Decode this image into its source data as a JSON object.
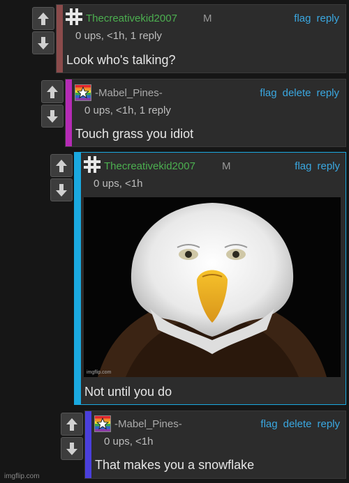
{
  "colors": {
    "background": "#161616",
    "card": "#2c2c2c",
    "link": "#3aa7e0",
    "green_user": "#4caf50",
    "bar_1": "#8b4b4b",
    "bar_2": "#b52bb5",
    "bar_3": "#1aa9e0",
    "bar_4": "#4a3fdc"
  },
  "comments": [
    {
      "username": "Thecreativekid2007",
      "tag": "M",
      "meta": "0 ups, <1h, 1 reply",
      "text": "Look who's talking?",
      "actions": [
        "flag",
        "reply"
      ],
      "icon": "hash-icon"
    },
    {
      "username": "-Mabel_Pines-",
      "tag": "",
      "meta": "0 ups, <1h, 1 reply",
      "text": "Touch grass you idiot",
      "actions": [
        "flag",
        "delete",
        "reply"
      ],
      "icon": "rainbow-star-icon"
    },
    {
      "username": "Thecreativekid2007",
      "tag": "M",
      "meta": "0 ups, <1h",
      "text": "Not until you do",
      "actions": [
        "flag",
        "reply"
      ],
      "icon": "hash-icon",
      "image_watermark": "imgflip.com"
    },
    {
      "username": "-Mabel_Pines-",
      "tag": "",
      "meta": "0 ups, <1h",
      "text": "That makes you a snowflake",
      "actions": [
        "flag",
        "delete",
        "reply"
      ],
      "icon": "rainbow-star-icon"
    }
  ],
  "page_watermark": "imgflip.com"
}
